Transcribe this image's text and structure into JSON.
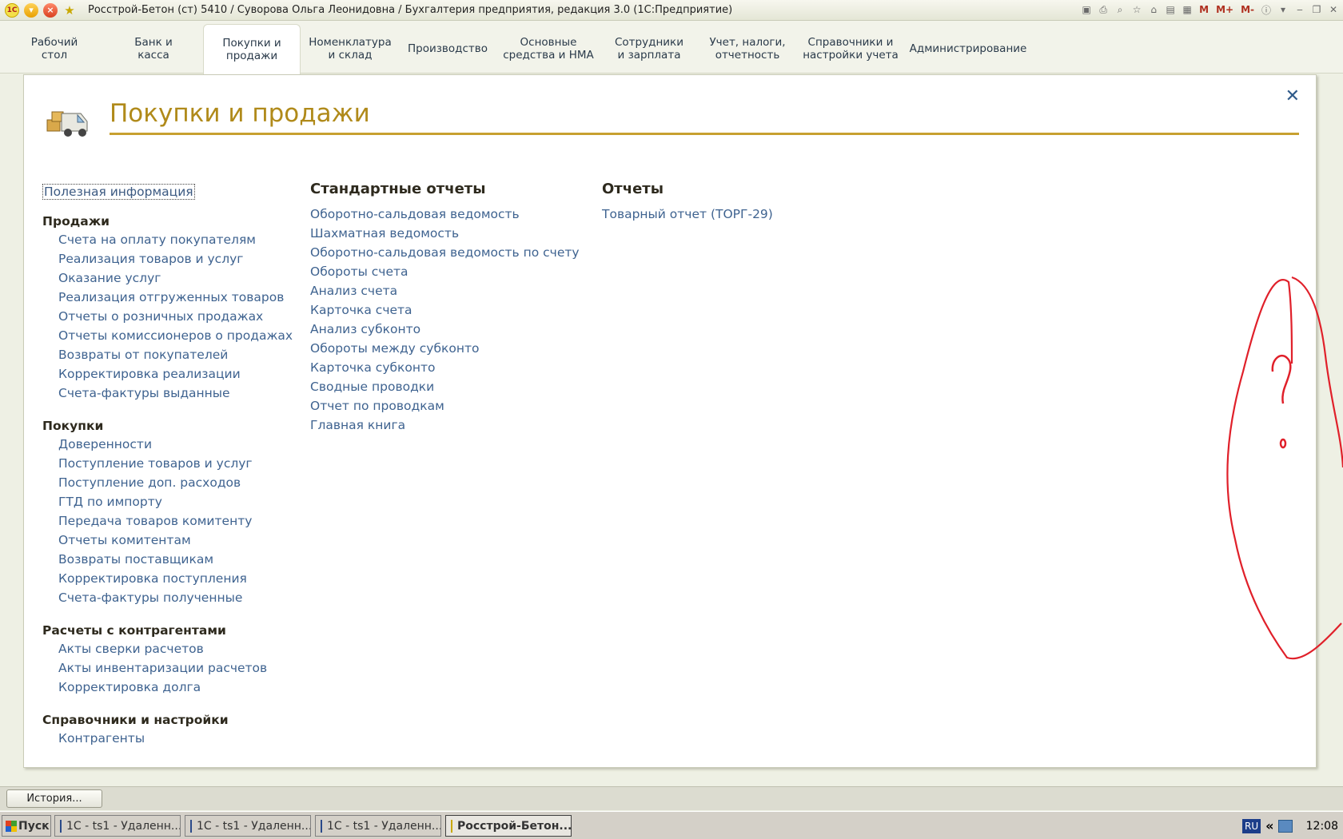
{
  "window": {
    "title": "Росстрой-Бетон (ст) 5410 / Суворова Ольга Леонидовна / Бухгалтерия предприятия, редакция 3.0  (1С:Предприятие)",
    "app_logo": "1С",
    "tools_m": [
      "M",
      "M+",
      "M-"
    ]
  },
  "sections": [
    {
      "label": "Рабочий\nстол"
    },
    {
      "label": "Банк и\nкасса"
    },
    {
      "label": "Покупки и\nпродажи",
      "active": true
    },
    {
      "label": "Номенклатура\nи склад"
    },
    {
      "label": "Производство"
    },
    {
      "label": "Основные\nсредства и НМА"
    },
    {
      "label": "Сотрудники\nи зарплата"
    },
    {
      "label": "Учет, налоги,\nотчетность"
    },
    {
      "label": "Справочники и\nнастройки учета"
    },
    {
      "label": "Администрирование"
    }
  ],
  "page": {
    "title": "Покупки и продажи",
    "useful_info": "Полезная информация",
    "groups": [
      {
        "title": "Продажи",
        "items": [
          "Счета на оплату покупателям",
          "Реализация товаров и услуг",
          "Оказание услуг",
          "Реализация отгруженных товаров",
          "Отчеты о розничных продажах",
          "Отчеты комиссионеров о продажах",
          "Возвраты от покупателей",
          "Корректировка реализации",
          "Счета-фактуры выданные"
        ]
      },
      {
        "title": "Покупки",
        "items": [
          "Доверенности",
          "Поступление товаров и услуг",
          "Поступление доп. расходов",
          "ГТД по импорту",
          "Передача товаров комитенту",
          "Отчеты комитентам",
          "Возвраты поставщикам",
          "Корректировка поступления",
          "Счета-фактуры полученные"
        ]
      },
      {
        "title": "Расчеты с контрагентами",
        "items": [
          "Акты сверки расчетов",
          "Акты инвентаризации расчетов",
          "Корректировка долга"
        ]
      },
      {
        "title": "Справочники и настройки",
        "items": [
          "Контрагенты"
        ]
      }
    ],
    "standard_reports": {
      "title": "Стандартные отчеты",
      "items": [
        "Оборотно-сальдовая ведомость",
        "Шахматная ведомость",
        "Оборотно-сальдовая ведомость по счету",
        "Обороты счета",
        "Анализ счета",
        "Карточка счета",
        "Анализ субконто",
        "Обороты между субконто",
        "Карточка субконто",
        "Сводные проводки",
        "Отчет по проводкам",
        "Главная книга"
      ]
    },
    "reports": {
      "title": "Отчеты",
      "items": [
        "Товарный отчет (ТОРГ-29)"
      ]
    }
  },
  "bottom": {
    "history": "История..."
  },
  "taskbar": {
    "start": "Пуск",
    "tasks": [
      "1С - ts1 - Удаленн...",
      "1С - ts1 - Удаленн...",
      "1С - ts1 - Удаленн...",
      "Росстрой-Бетон..."
    ],
    "lang": "RU",
    "arrows": "«",
    "clock": "12:08"
  },
  "colors": {
    "title": "#b08a1a",
    "link": "#3f6390",
    "annotation": "#e0202a"
  }
}
